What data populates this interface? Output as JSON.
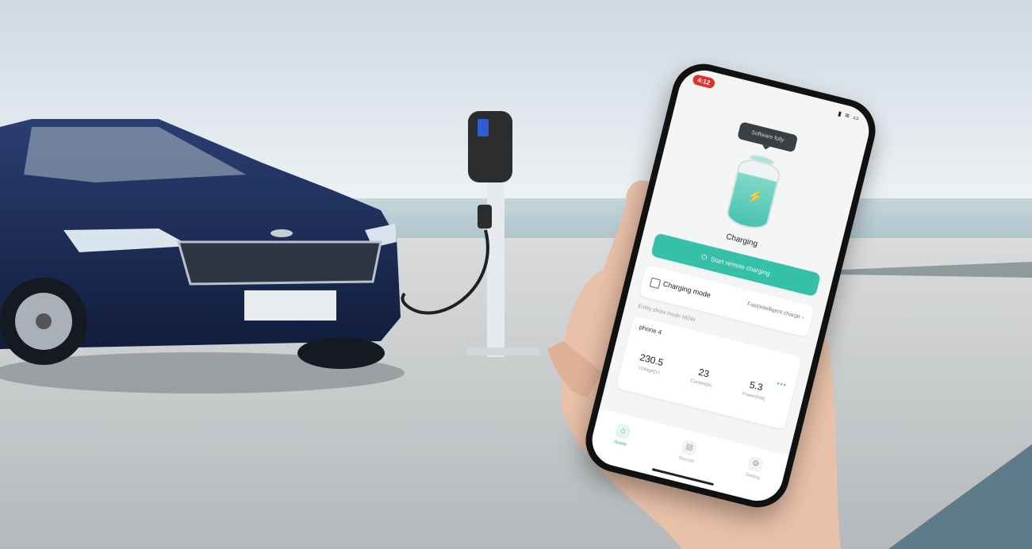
{
  "colors": {
    "accent": "#36c0a7",
    "status_pill": "#e0312f",
    "car_body": "#1c2c55",
    "sky": "#dfe7ee",
    "ground": "#c9cbcc"
  },
  "phone": {
    "status_time": "4:12",
    "bubble_text": "Software fully",
    "charging_label": "Charging",
    "primary_button_label": "Start remote charging",
    "charging_mode": {
      "label": "Charging mode",
      "value": "Fast/intelligent charge"
    },
    "hint_text": "Entity show mode NOW",
    "stats_card": {
      "title": "phone 4",
      "stats": [
        {
          "value": "230.5",
          "label": "Voltage(V)"
        },
        {
          "value": "23",
          "label": "Current(A)"
        },
        {
          "value": "5.3",
          "label": "Power(kW)"
        }
      ]
    },
    "tabs": [
      {
        "label": "Home",
        "icon": "home-icon",
        "active": true
      },
      {
        "label": "Record",
        "icon": "record-icon",
        "active": false
      },
      {
        "label": "Setting",
        "icon": "gear-icon",
        "active": false
      }
    ]
  }
}
